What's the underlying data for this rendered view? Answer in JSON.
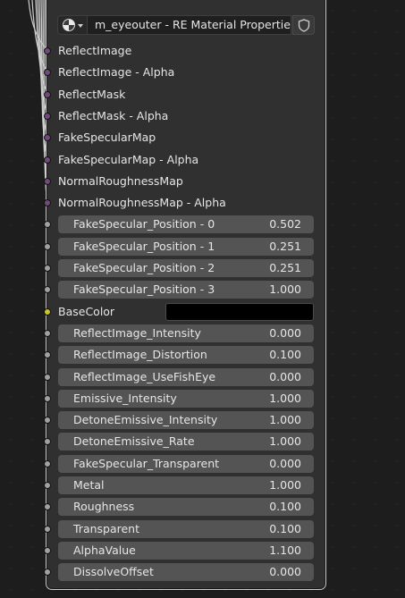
{
  "header": {
    "material_name": "m_eyeouter - RE Material Properties",
    "material_icon": "material-sphere-icon",
    "shield_icon": "shield-icon"
  },
  "socket_inputs": [
    {
      "label": "ReflectImage",
      "socket": "purple"
    },
    {
      "label": "ReflectImage - Alpha",
      "socket": "purple"
    },
    {
      "label": "ReflectMask",
      "socket": "purple"
    },
    {
      "label": "ReflectMask - Alpha",
      "socket": "purple"
    },
    {
      "label": "FakeSpecularMap",
      "socket": "purple"
    },
    {
      "label": "FakeSpecularMap - Alpha",
      "socket": "purple"
    },
    {
      "label": "NormalRoughnessMap",
      "socket": "purple"
    },
    {
      "label": "NormalRoughnessMap - Alpha",
      "socket": "purple"
    }
  ],
  "fake_specular_fields": [
    {
      "name": "FakeSpecular_Position - 0",
      "value": "0.502"
    },
    {
      "name": "FakeSpecular_Position - 1",
      "value": "0.251"
    },
    {
      "name": "FakeSpecular_Position - 2",
      "value": "0.251"
    },
    {
      "name": "FakeSpecular_Position - 3",
      "value": "1.000"
    }
  ],
  "base_color": {
    "label": "BaseColor",
    "color": "#000000"
  },
  "value_fields": [
    {
      "name": "ReflectImage_Intensity",
      "value": "0.000"
    },
    {
      "name": "ReflectImage_Distortion",
      "value": "0.100"
    },
    {
      "name": "ReflectImage_UseFishEye",
      "value": "0.000"
    },
    {
      "name": "Emissive_Intensity",
      "value": "1.000"
    },
    {
      "name": "DetoneEmissive_Intensity",
      "value": "1.000"
    },
    {
      "name": "DetoneEmissive_Rate",
      "value": "1.000"
    },
    {
      "name": "FakeSpecular_Transparent",
      "value": "0.000"
    },
    {
      "name": "Metal",
      "value": "1.000"
    },
    {
      "name": "Roughness",
      "value": "0.100"
    },
    {
      "name": "Transparent",
      "value": "0.100"
    },
    {
      "name": "AlphaValue",
      "value": "1.100"
    },
    {
      "name": "DissolveOffset",
      "value": "0.000"
    }
  ],
  "colors": {
    "node_bg": "#303030",
    "field_bg": "#545454",
    "socket_image": "#6f4a7a",
    "socket_float": "#a1a1a1",
    "socket_color": "#c7c729"
  }
}
